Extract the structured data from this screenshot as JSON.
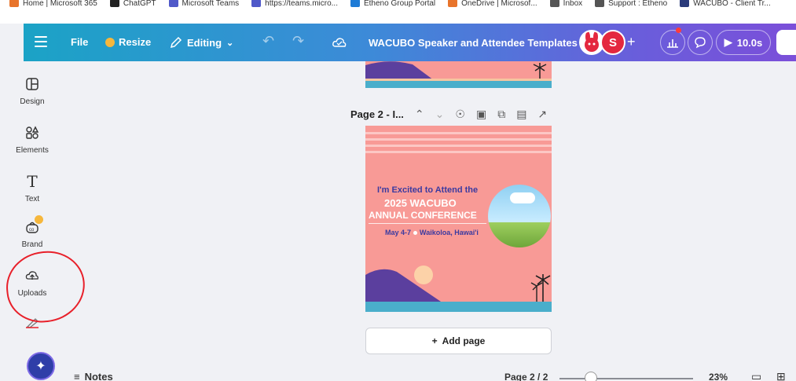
{
  "bookmarks": [
    {
      "label": "Home | Microsoft 365",
      "color": "#e8742b"
    },
    {
      "label": "ChatGPT",
      "color": "#222222"
    },
    {
      "label": "Microsoft Teams",
      "color": "#5059c9"
    },
    {
      "label": "https://teams.micro...",
      "color": "#5059c9"
    },
    {
      "label": "Etheno Group Portal",
      "color": "#1e7bd6"
    },
    {
      "label": "OneDrive | Microsof...",
      "color": "#e8742b"
    },
    {
      "label": "Inbox",
      "color": "#555555"
    },
    {
      "label": "Support : Etheno",
      "color": "#555555"
    },
    {
      "label": "WACUBO - Client Tr...",
      "color": "#2a3a7a"
    }
  ],
  "toolbar": {
    "file_label": "File",
    "resize_label": "Resize",
    "editing_label": "Editing",
    "title": "WACUBO Speaker and Attendee Templates",
    "avatar_initial": "S",
    "timer_label": "10.0s"
  },
  "sidebar": {
    "items": [
      {
        "label": "Design",
        "icon": "design-icon"
      },
      {
        "label": "Elements",
        "icon": "elements-icon"
      },
      {
        "label": "Text",
        "icon": "text-icon"
      },
      {
        "label": "Brand",
        "icon": "brand-icon"
      },
      {
        "label": "Uploads",
        "icon": "upload-icon"
      }
    ]
  },
  "page_toolbar": {
    "label": "Page 2 - I..."
  },
  "design": {
    "line1": "I'm Excited to Attend the",
    "line2": "2025 WACUBO",
    "line3": "ANNUAL CONFERENCE",
    "dates": "May 4-7",
    "location": "Waikoloa, Hawai'i",
    "bg_color": "#f89a96",
    "accent_color": "#3b3aa0"
  },
  "add_page_label": "Add page",
  "bottom": {
    "notes_label": "Notes",
    "page_indicator": "Page 2 / 2",
    "zoom": "23%",
    "zoom_fraction": 0.23
  },
  "colors": {
    "toolbar_start": "#1ba3c6",
    "toolbar_end": "#7b4fd9",
    "annotation": "#e8202a"
  }
}
